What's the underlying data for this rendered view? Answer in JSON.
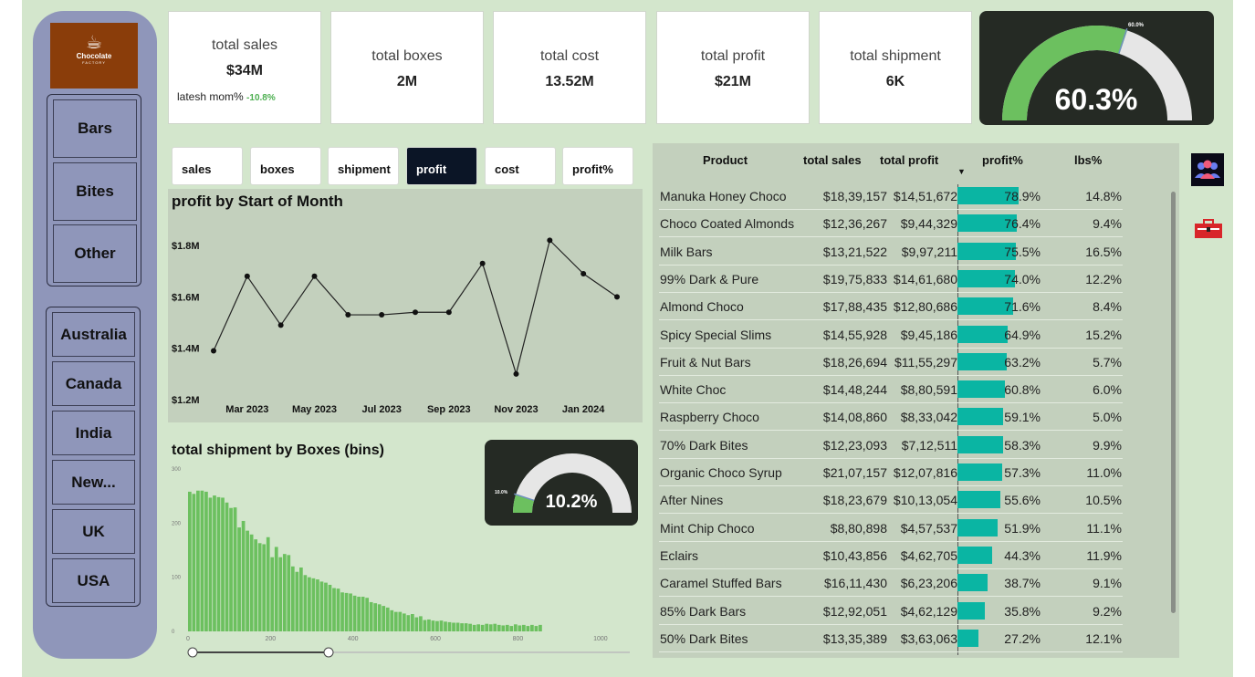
{
  "logo": {
    "name": "Chocolate",
    "sub": "FACTORY"
  },
  "categories": [
    "Bars",
    "Bites",
    "Other"
  ],
  "countries": [
    "Australia",
    "Canada",
    "India",
    "New...",
    "UK",
    "USA"
  ],
  "kpis": [
    {
      "label": "total sales",
      "value": "$34M"
    },
    {
      "label": "total boxes",
      "value": "2M"
    },
    {
      "label": "total cost",
      "value": "13.52M"
    },
    {
      "label": "total profit",
      "value": "$21M"
    },
    {
      "label": "total shipment",
      "value": "6K"
    }
  ],
  "mom": {
    "label": "latesh mom%",
    "value": "-10.8%"
  },
  "gauge_main": {
    "value": "60.3%",
    "target_label": "60.0%",
    "fraction": 0.603,
    "target": 0.6
  },
  "gauge_small": {
    "value": "10.2%",
    "target_label": "10.0%",
    "fraction": 0.102,
    "target": 0.1
  },
  "tabs": [
    "sales",
    "boxes",
    "shipment",
    "profit",
    "cost",
    "profit%"
  ],
  "active_tab": "profit",
  "colors": {
    "accent": "#0ab5a3",
    "gauge": "#6cc05f",
    "dark": "#252a24",
    "bar": "#6cc05f"
  },
  "chart_data": [
    {
      "type": "line",
      "title": "profit by Start of Month",
      "x": [
        "Feb 2023",
        "Mar 2023",
        "Apr 2023",
        "May 2023",
        "Jun 2023",
        "Jul 2023",
        "Aug 2023",
        "Sep 2023",
        "Oct 2023",
        "Nov 2023",
        "Dec 2023",
        "Jan 2024",
        "Feb 2024"
      ],
      "x_tick_labels": [
        "Mar 2023",
        "May 2023",
        "Jul 2023",
        "Sep 2023",
        "Nov 2023",
        "Jan 2024"
      ],
      "values": [
        1.39,
        1.68,
        1.49,
        1.68,
        1.53,
        1.53,
        1.54,
        1.54,
        1.73,
        1.3,
        1.82,
        1.69,
        1.6
      ],
      "y_tick_labels": [
        "$1.2M",
        "$1.4M",
        "$1.6M",
        "$1.8M"
      ],
      "ylim": [
        1.2,
        1.85
      ]
    },
    {
      "type": "bar",
      "title": "total shipment by Boxes (bins)",
      "x_tick_labels": [
        "0",
        "200",
        "400",
        "600",
        "800",
        "1000"
      ],
      "y_tick_labels": [
        "0",
        "100",
        "200",
        "300"
      ],
      "ylim": [
        0,
        300
      ],
      "xlim": [
        0,
        1080
      ],
      "bin_width": 10,
      "values": [
        258,
        254,
        260,
        260,
        258,
        247,
        251,
        248,
        247,
        238,
        228,
        229,
        192,
        204,
        186,
        179,
        170,
        163,
        161,
        174,
        137,
        156,
        137,
        143,
        141,
        120,
        110,
        118,
        104,
        100,
        98,
        96,
        92,
        90,
        86,
        80,
        79,
        72,
        71,
        70,
        66,
        64,
        64,
        62,
        54,
        52,
        50,
        47,
        44,
        39,
        36,
        36,
        33,
        30,
        32,
        26,
        28,
        21,
        22,
        20,
        19,
        20,
        18,
        17,
        16,
        16,
        15,
        15,
        14,
        12,
        13,
        12,
        14,
        13,
        14,
        12,
        11,
        12,
        10,
        13,
        11,
        12,
        10,
        12,
        10,
        12
      ]
    },
    {
      "type": "table",
      "columns": [
        "Product",
        "total sales",
        "total profit",
        "profit%",
        "lbs%"
      ],
      "rows": [
        [
          "Manuka Honey Choco",
          "$18,39,157",
          "$14,51,672",
          "78.9%",
          "14.8%"
        ],
        [
          "Choco Coated Almonds",
          "$12,36,267",
          "$9,44,329",
          "76.4%",
          "9.4%"
        ],
        [
          "Milk Bars",
          "$13,21,522",
          "$9,97,211",
          "75.5%",
          "16.5%"
        ],
        [
          "99% Dark & Pure",
          "$19,75,833",
          "$14,61,680",
          "74.0%",
          "12.2%"
        ],
        [
          "Almond Choco",
          "$17,88,435",
          "$12,80,686",
          "71.6%",
          "8.4%"
        ],
        [
          "Spicy Special Slims",
          "$14,55,928",
          "$9,45,186",
          "64.9%",
          "15.2%"
        ],
        [
          "Fruit & Nut Bars",
          "$18,26,694",
          "$11,55,297",
          "63.2%",
          "5.7%"
        ],
        [
          "White Choc",
          "$14,48,244",
          "$8,80,591",
          "60.8%",
          "6.0%"
        ],
        [
          "Raspberry Choco",
          "$14,08,860",
          "$8,33,042",
          "59.1%",
          "5.0%"
        ],
        [
          "70% Dark Bites",
          "$12,23,093",
          "$7,12,511",
          "58.3%",
          "9.9%"
        ],
        [
          "Organic Choco Syrup",
          "$21,07,157",
          "$12,07,816",
          "57.3%",
          "11.0%"
        ],
        [
          "After Nines",
          "$18,23,679",
          "$10,13,054",
          "55.6%",
          "10.5%"
        ],
        [
          "Mint Chip Choco",
          "$8,80,898",
          "$4,57,537",
          "51.9%",
          "11.1%"
        ],
        [
          "Eclairs",
          "$10,43,856",
          "$4,62,705",
          "44.3%",
          "11.9%"
        ],
        [
          "Caramel Stuffed Bars",
          "$16,11,430",
          "$6,23,206",
          "38.7%",
          "9.1%"
        ],
        [
          "85% Dark Bars",
          "$12,92,051",
          "$4,62,129",
          "35.8%",
          "9.2%"
        ],
        [
          "50% Dark Bites",
          "$13,35,389",
          "$3,63,063",
          "27.2%",
          "12.1%"
        ]
      ]
    }
  ]
}
